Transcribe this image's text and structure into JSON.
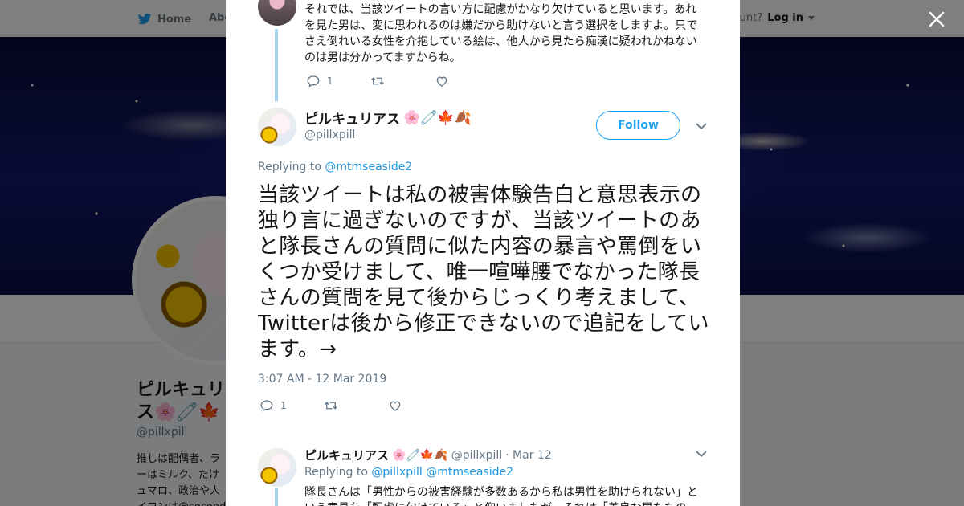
{
  "nav": {
    "home_label": "Home",
    "about_label": "Abo",
    "account_prompt": "ccount?",
    "login_label": "Log in"
  },
  "background_profile": {
    "name": "ピルキュリ ス🌸🧷🍁",
    "handle": "@pillxpill",
    "bio_lines": [
      "推しは配偶者、ラ",
      "ーはミルク、たけ",
      "ュマロ、政治や人",
      "イコンは@second"
    ]
  },
  "thread_top": {
    "text": "それでは、当該ツイートの言い方に配慮がかなり欠けていると思います。あれを見た男は、変に思われるのは嫌だから助けないと言う選択をしますよ。只でさえ倒れいる女性を介抱している絵は、他人から見たら痴漢に疑われかねないのは男は分かってますからね。",
    "reply_count": "1"
  },
  "main_tweet": {
    "name": "ピルキュリアス",
    "emoji": "🌸🧷🍁🍂",
    "handle": "@pillxpill",
    "follow_label": "Follow",
    "replying_prefix": "Replying to",
    "replying_to": "@mtmseaside2",
    "text": "当該ツイートは私の被害体験告白と意思表示の独り言に過ぎないのですが、当該ツイートのあと隊長さんの質問に似た内容の暴言や罵倒をいくつか受けまして、唯一喧嘩腰でなかった隊長さんの質問を見て後からじっくり考えまして、Twitterは後から修正できないので追記をしています。→",
    "timestamp": "3:07 AM - 12 Mar 2019",
    "reply_count": "1"
  },
  "reply_tweet": {
    "name": "ピルキュリアス",
    "emoji": "🌸🧷🍁🍂",
    "handle": "@pillxpill",
    "date": "· Mar 12",
    "replying_prefix": "Replying to",
    "replying_to": "@pillxpill @mtmseaside2",
    "text": "隊長さんは「男性からの被害経験が多数あるから私は男性を助けられない」という意見を「配慮に欠けている」と仰いましたが、それは「善良な男たちの"
  },
  "colors": {
    "accent": "#1da1f2",
    "thread_line": "#a5d4ef",
    "muted": "#657786"
  }
}
